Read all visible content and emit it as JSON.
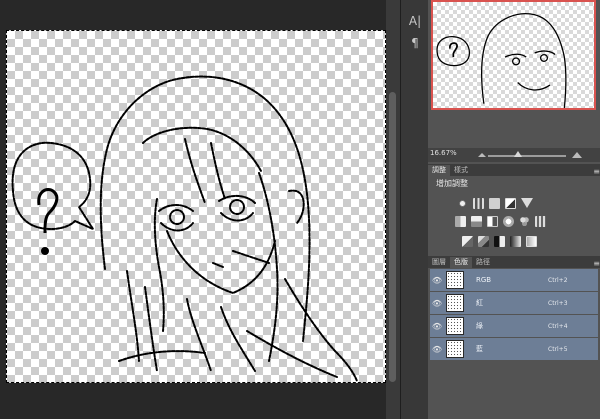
{
  "tools": [
    {
      "icon": "character-panel-icon",
      "glyph": "A|"
    },
    {
      "icon": "paragraph-panel-icon",
      "glyph": "¶"
    }
  ],
  "navigator": {
    "zoom": "16.67%"
  },
  "adjustments": {
    "tabs": [
      "調整",
      "樣式"
    ],
    "active_tab": "調整",
    "title": "增加調整",
    "row1_icons": [
      "brightness-contrast-icon",
      "levels-icon",
      "curves-icon",
      "exposure-icon",
      "triangle-icon"
    ],
    "row2_icons": [
      "vibrance-icon",
      "hue-saturation-icon",
      "color-balance-icon",
      "black-white-icon",
      "photo-filter-icon",
      "channel-mixer-icon"
    ],
    "row3_icons": [
      "invert-icon",
      "posterize-icon",
      "threshold-icon",
      "gradient-map-icon",
      "selective-color-icon"
    ]
  },
  "channels_panel": {
    "tabs": [
      "圖層",
      "色版",
      "路徑"
    ],
    "active_tab": "色版",
    "rows": [
      {
        "name": "RGB",
        "shortcut": "Ctrl+2"
      },
      {
        "name": "紅",
        "shortcut": "Ctrl+3"
      },
      {
        "name": "綠",
        "shortcut": "Ctrl+4"
      },
      {
        "name": "藍",
        "shortcut": "Ctrl+5"
      }
    ]
  },
  "colors": {
    "channel_row": "#6d7e96",
    "navigator_frame": "#d9534f"
  }
}
